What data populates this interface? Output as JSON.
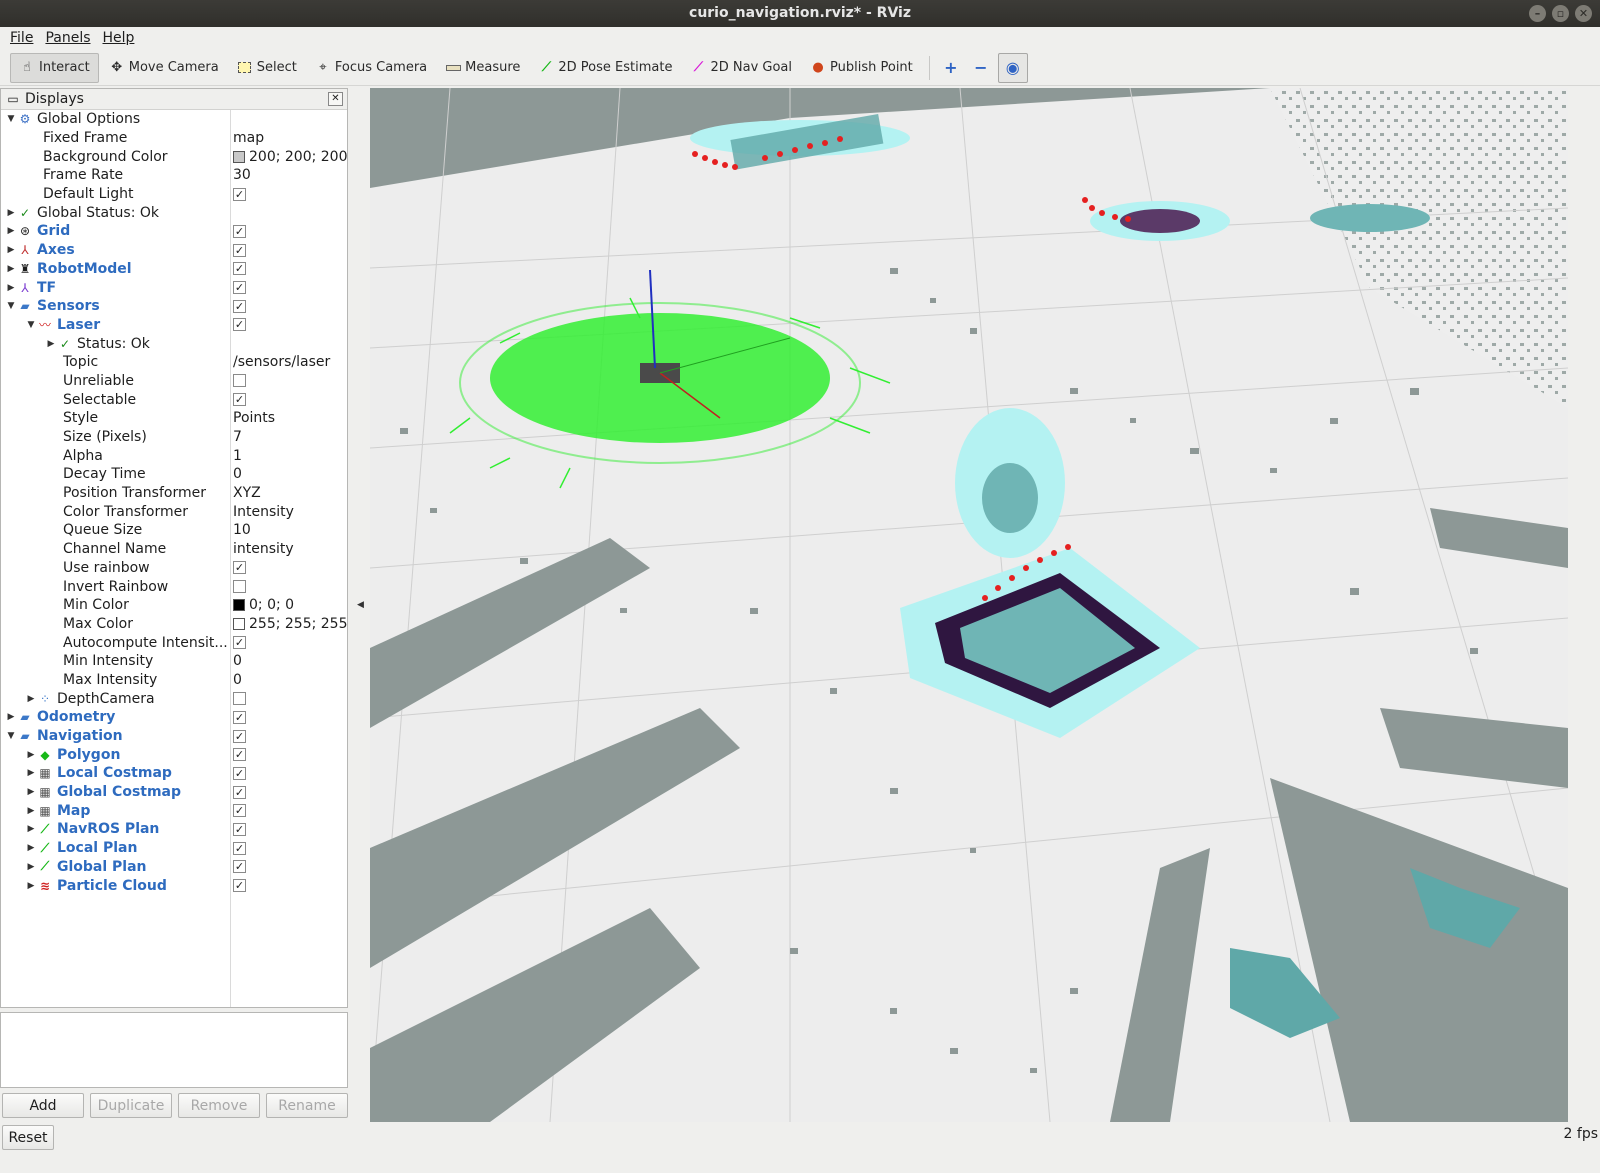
{
  "window": {
    "title": "curio_navigation.rviz* - RViz"
  },
  "menu": [
    {
      "label": "File"
    },
    {
      "label": "Panels"
    },
    {
      "label": "Help"
    }
  ],
  "toolbar": {
    "tools": [
      {
        "label": "Interact",
        "icon": "hand-icon"
      },
      {
        "label": "Move Camera",
        "icon": "move-camera-icon"
      },
      {
        "label": "Select",
        "icon": "select-icon"
      },
      {
        "label": "Focus Camera",
        "icon": "focus-camera-icon"
      },
      {
        "label": "Measure",
        "icon": "ruler-icon"
      },
      {
        "label": "2D Pose Estimate",
        "icon": "pose-arrow-icon"
      },
      {
        "label": "2D Nav Goal",
        "icon": "nav-goal-arrow-icon"
      },
      {
        "label": "Publish Point",
        "icon": "map-pin-icon"
      }
    ]
  },
  "displays": {
    "title": "Displays",
    "rows": [
      {
        "name": "Global Options",
        "value": ""
      },
      {
        "name": "Fixed Frame",
        "value": "map"
      },
      {
        "name": "Background Color",
        "value": "200; 200; 200"
      },
      {
        "name": "Frame Rate",
        "value": "30"
      },
      {
        "name": "Default Light",
        "value": ""
      },
      {
        "name": "Global Status: Ok",
        "value": ""
      },
      {
        "name": "Grid",
        "value": ""
      },
      {
        "name": "Axes",
        "value": ""
      },
      {
        "name": "RobotModel",
        "value": ""
      },
      {
        "name": "TF",
        "value": ""
      },
      {
        "name": "Sensors",
        "value": ""
      },
      {
        "name": "Laser",
        "value": ""
      },
      {
        "name": "Status: Ok",
        "value": ""
      },
      {
        "name": "Topic",
        "value": "/sensors/laser"
      },
      {
        "name": "Unreliable",
        "value": ""
      },
      {
        "name": "Selectable",
        "value": ""
      },
      {
        "name": "Style",
        "value": "Points"
      },
      {
        "name": "Size (Pixels)",
        "value": "7"
      },
      {
        "name": "Alpha",
        "value": "1"
      },
      {
        "name": "Decay Time",
        "value": "0"
      },
      {
        "name": "Position Transformer",
        "value": "XYZ"
      },
      {
        "name": "Color Transformer",
        "value": "Intensity"
      },
      {
        "name": "Queue Size",
        "value": "10"
      },
      {
        "name": "Channel Name",
        "value": "intensity"
      },
      {
        "name": "Use rainbow",
        "value": ""
      },
      {
        "name": "Invert Rainbow",
        "value": ""
      },
      {
        "name": "Min Color",
        "value": "0; 0; 0"
      },
      {
        "name": "Max Color",
        "value": "255; 255; 255"
      },
      {
        "name": "Autocompute Intensit...",
        "value": ""
      },
      {
        "name": "Min Intensity",
        "value": "0"
      },
      {
        "name": "Max Intensity",
        "value": "0"
      },
      {
        "name": "DepthCamera",
        "value": ""
      },
      {
        "name": "Odometry",
        "value": ""
      },
      {
        "name": "Navigation",
        "value": ""
      },
      {
        "name": "Polygon",
        "value": ""
      },
      {
        "name": "Local Costmap",
        "value": ""
      },
      {
        "name": "Global Costmap",
        "value": ""
      },
      {
        "name": "Map",
        "value": ""
      },
      {
        "name": "NavROS Plan",
        "value": ""
      },
      {
        "name": "Local Plan",
        "value": ""
      },
      {
        "name": "Global Plan",
        "value": ""
      },
      {
        "name": "Particle Cloud",
        "value": ""
      }
    ]
  },
  "buttons": {
    "add": "Add",
    "duplicate": "Duplicate",
    "remove": "Remove",
    "rename": "Rename",
    "reset": "Reset"
  },
  "status": {
    "fps": "2 fps"
  }
}
